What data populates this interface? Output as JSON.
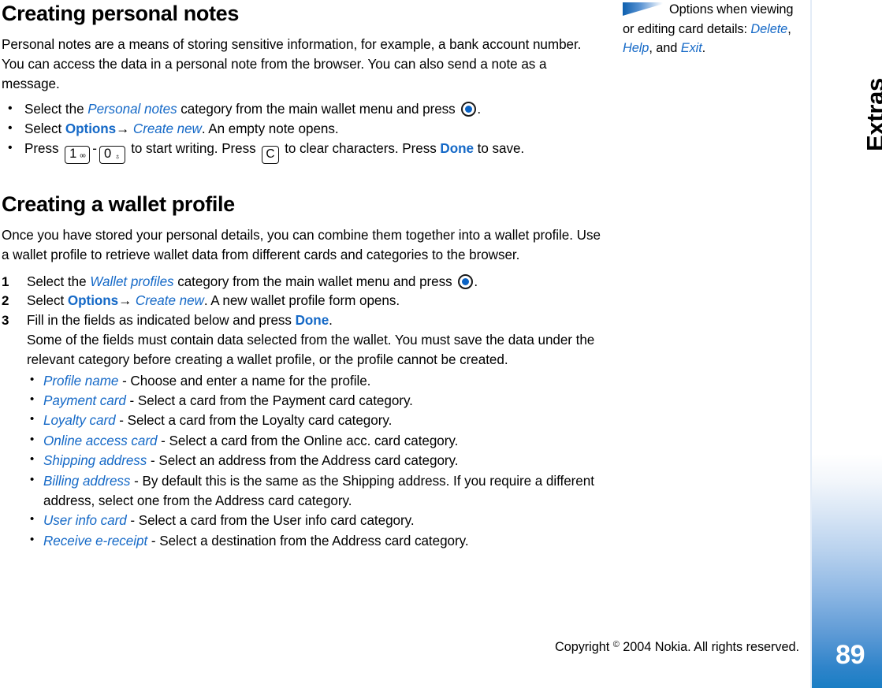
{
  "sections": [
    {
      "heading": "Creating personal notes",
      "intro": "Personal notes are a means of storing sensitive information, for example, a bank account number. You can access the data in a personal note from the browser. You can also send a note as a message.",
      "bullets": {
        "b1_a": "Select the ",
        "b1_ui": "Personal notes",
        "b1_b": " category from the main wallet menu and press ",
        "b1_c": ".",
        "b2_a": "Select ",
        "b2_opt": "Options",
        "b2_arrow": "→",
        "b2_new": "Create new",
        "b2_b": ". An empty note opens.",
        "b3_a": "Press ",
        "b3_key1_digit": "1",
        "b3_key1_sym": "ᵒᵒ",
        "b3_dash": "-",
        "b3_key2_digit": "0",
        "b3_key2_sym": "♁",
        "b3_b": " to start writing. Press ",
        "b3_keyc": "C",
        "b3_c": " to clear characters. Press ",
        "b3_done": "Done",
        "b3_d": " to save."
      }
    },
    {
      "heading": "Creating a wallet profile",
      "intro": "Once you have stored your personal details, you can combine them together into a wallet profile. Use a wallet profile to retrieve wallet data from different cards and categories to the browser.",
      "steps": [
        {
          "num": "1",
          "a": "Select the ",
          "ui": "Wallet profiles",
          "b": " category from the main wallet menu and press ",
          "c": "."
        },
        {
          "num": "2",
          "a": "Select ",
          "opt": "Options",
          "arrow": "→",
          "new": "Create new",
          "b": ". A new wallet profile form opens."
        },
        {
          "num": "3",
          "a": "Fill in the fields as indicated below and press ",
          "done": "Done",
          "b": ".",
          "note": "Some of the fields must contain data selected from the wallet. You must save the data under the relevant category before creating a wallet profile, or the profile cannot be created."
        }
      ],
      "field_list": [
        {
          "field": "Profile name",
          "desc": " - Choose and enter a name for the profile."
        },
        {
          "field": "Payment card",
          "desc": " - Select a card from the Payment card category."
        },
        {
          "field": "Loyalty card",
          "desc": " - Select a card from the Loyalty card category."
        },
        {
          "field": "Online access card",
          "desc": " - Select a card from the Online acc. card category."
        },
        {
          "field": "Shipping address",
          "desc": " - Select an address from the Address card category."
        },
        {
          "field": "Billing address",
          "desc": " - By default this is the same as the Shipping address. If you require a different address, select one from the Address card category."
        },
        {
          "field": "User info card",
          "desc": " - Select a card from the User info card category."
        },
        {
          "field": "Receive e-receipt",
          "desc": " - Select a destination from the Address card category."
        }
      ]
    }
  ],
  "margin_note": {
    "text_a": "Options when viewing or editing card details: ",
    "ui_delete": "Delete",
    "sep1": ", ",
    "ui_help": "Help",
    "sep2": ", and ",
    "ui_exit": "Exit",
    "end": "."
  },
  "edge_bar": {
    "title": "Extras",
    "page_number": "89"
  },
  "footer": {
    "copyright_pre": "Copyright ",
    "copyright_sym": "©",
    "copyright_post": " 2004 Nokia. All rights reserved."
  },
  "colors": {
    "accent_blue": "#1569c7",
    "bar_blue": "#1a7ec4",
    "text_black": "#000000"
  }
}
